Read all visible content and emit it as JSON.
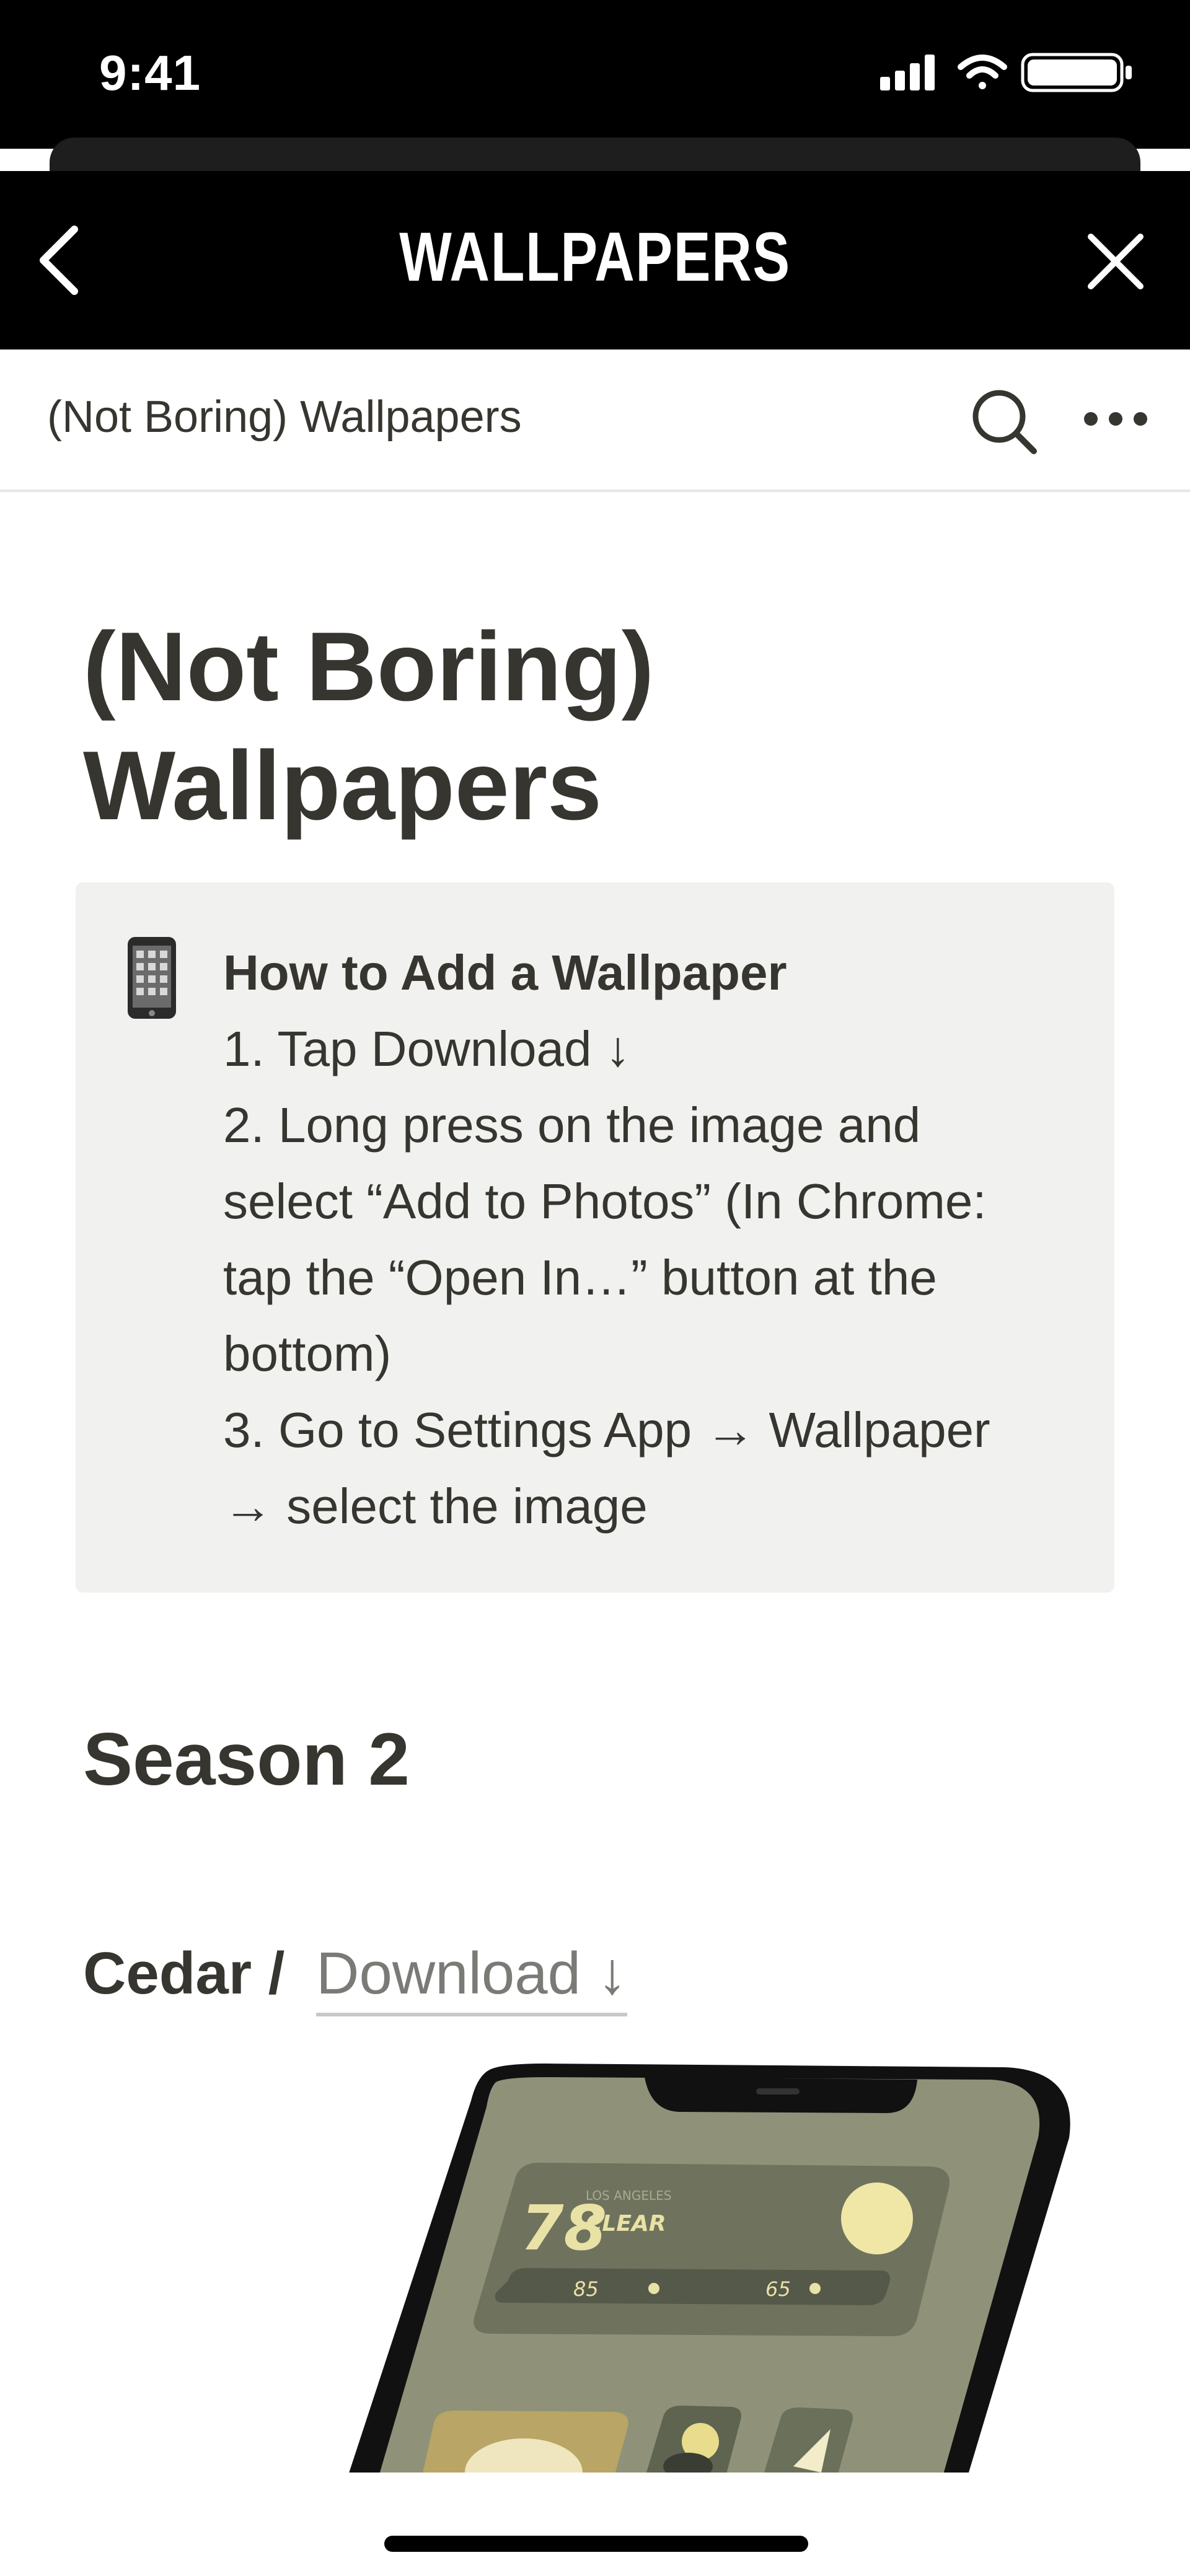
{
  "status_bar": {
    "time": "9:41"
  },
  "nav": {
    "title": "WALLPAPERS",
    "back_icon": "chevron-left-icon",
    "close_icon": "close-icon"
  },
  "toolbar": {
    "breadcrumb": "(Not Boring) Wallpapers",
    "search_icon": "search-icon",
    "more_icon": "more-icon"
  },
  "page": {
    "title_line1": "(Not Boring)",
    "title_line2": "Wallpapers",
    "callout": {
      "icon": "📱",
      "heading": "How to Add a Wallpaper",
      "lines": [
        "1. Tap Download ↓",
        "2. Long press on the image and",
        "select “Add to Photos” (In Chrome:",
        "tap the “Open In…” button at the",
        "bottom)",
        "3. Go to Settings App → Wallpaper",
        "→ select the image"
      ]
    },
    "section_heading": "Season 2",
    "item": {
      "name": "Cedar",
      "separator": "/",
      "download_label": "Download ↓"
    },
    "phone_widget": {
      "temp": "78",
      "location": "LOS ANGELES",
      "condition": "CLEAR",
      "high": "85",
      "low": "65"
    }
  },
  "colors": {
    "text": "#37352f",
    "callout_bg": "#f1f1ef",
    "bar_bg": "#000000",
    "link": "#7a7a76"
  }
}
